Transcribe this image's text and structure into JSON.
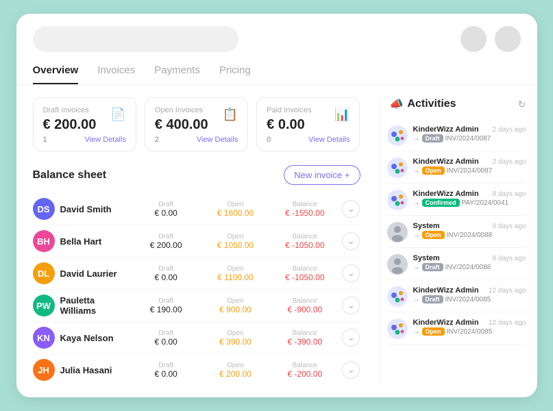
{
  "topBar": {
    "searchPlaceholder": ""
  },
  "tabs": [
    {
      "label": "Overview",
      "active": true
    },
    {
      "label": "Invoices",
      "active": false
    },
    {
      "label": "Payments",
      "active": false
    },
    {
      "label": "Pricing",
      "active": false
    }
  ],
  "summaryCards": [
    {
      "title": "Draft Invoices",
      "amount": "€ 200.00",
      "count": "1",
      "viewDetails": "View Details",
      "icon": "📄"
    },
    {
      "title": "Open Invoices",
      "amount": "€ 400.00",
      "count": "2",
      "viewDetails": "View Details",
      "icon": "📋"
    },
    {
      "title": "Paid Invoices",
      "amount": "€ 0.00",
      "count": "0",
      "viewDetails": "View Details",
      "icon": "📊"
    }
  ],
  "balanceSheet": {
    "title": "Balance sheet",
    "newInvoiceLabel": "New invoice +"
  },
  "contacts": [
    {
      "name": "David Smith",
      "initials": "DS",
      "color": "#6366f1",
      "draft": "€ 0.00",
      "open": "€ 1600.00",
      "balance": "€ -1550.00"
    },
    {
      "name": "Bella Hart",
      "initials": "BH",
      "color": "#ec4899",
      "draft": "€ 200.00",
      "open": "€ 1050.00",
      "balance": "€ -1050.00"
    },
    {
      "name": "David Laurier",
      "initials": "DL",
      "color": "#f59e0b",
      "draft": "€ 0.00",
      "open": "€ 1100.00",
      "balance": "€ -1050.00"
    },
    {
      "name": "Pauletta Williams",
      "initials": "PW",
      "color": "#10b981",
      "draft": "€ 190.00",
      "open": "€ 900.00",
      "balance": "€ -900.00"
    },
    {
      "name": "Kaya Nelson",
      "initials": "KN",
      "color": "#8b5cf6",
      "draft": "€ 0.00",
      "open": "€ 390.00",
      "balance": "€ -390.00"
    },
    {
      "name": "Julia Hasani",
      "initials": "JH",
      "color": "#f97316",
      "draft": "€ 0.00",
      "open": "€ 200.00",
      "balance": "€ -200.00"
    }
  ],
  "activities": {
    "title": "Activities",
    "megaphoneIcon": "📣",
    "items": [
      {
        "user": "KinderWizz Admin",
        "time": "2 days ago",
        "badge": "Draft",
        "badgeClass": "badge-draft",
        "arrow": "→",
        "invoice": "INV/2024/0087",
        "avatarType": "colorful"
      },
      {
        "user": "KinderWizz Admin",
        "time": "2 days ago",
        "badge": "Open",
        "badgeClass": "badge-open",
        "arrow": "→",
        "invoice": "INV/2024/0087",
        "avatarType": "colorful"
      },
      {
        "user": "KinderWizz Admin",
        "time": "8 days ago",
        "badge": "Confirmed",
        "badgeClass": "badge-confirmed",
        "arrow": "→",
        "invoice": "PAY/2024/0041",
        "avatarType": "colorful"
      },
      {
        "user": "System",
        "time": "8 days ago",
        "badge": "Open",
        "badgeClass": "badge-open",
        "arrow": "→",
        "invoice": "INV/2024/0088",
        "avatarType": "gray"
      },
      {
        "user": "System",
        "time": "8 days ago",
        "badge": "Draft",
        "badgeClass": "badge-draft",
        "arrow": "→",
        "invoice": "INV/2024/0088",
        "avatarType": "gray"
      },
      {
        "user": "KinderWizz Admin",
        "time": "12 days ago",
        "badge": "Draft",
        "badgeClass": "badge-draft",
        "arrow": "→",
        "invoice": "INV/2024/0085",
        "avatarType": "colorful"
      },
      {
        "user": "KinderWizz Admin",
        "time": "12 days ago",
        "badge": "Open",
        "badgeClass": "badge-open",
        "arrow": "→",
        "invoice": "INV/2024/0085",
        "avatarType": "colorful"
      }
    ]
  }
}
